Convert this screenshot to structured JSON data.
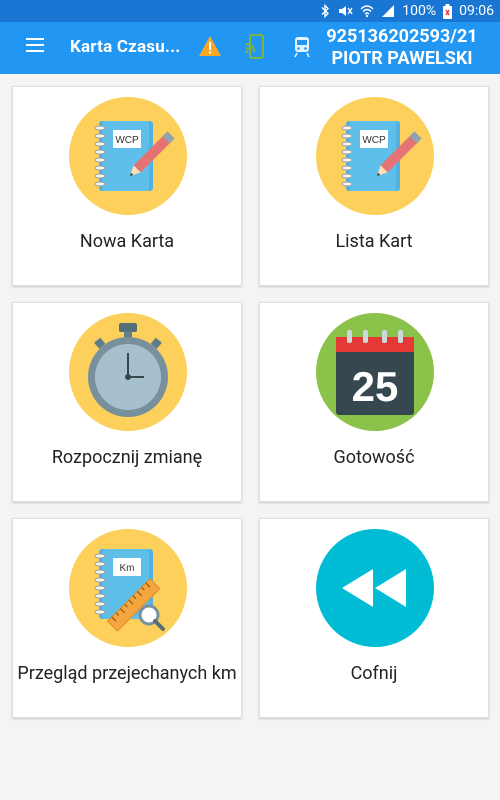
{
  "status_bar": {
    "battery": "100%",
    "time": "09:06",
    "icons": [
      "bluetooth-icon",
      "mute-icon",
      "wifi-icon",
      "signal-icon",
      "battery-icon"
    ]
  },
  "app_bar": {
    "title": "Karta Czasu...",
    "menu_icon": "hamburger-menu-icon",
    "warning_icon": "warning-icon",
    "cast_icon": "cast-icon",
    "train_icon": "train-icon",
    "user_number": "925136202593/21",
    "user_name": "PIOTR PAWELSKI"
  },
  "tiles": [
    {
      "label": "Nowa Karta",
      "icon": "notebook-pencil-icon",
      "badge": "WCP"
    },
    {
      "label": "Lista Kart",
      "icon": "notebook-pencil-icon",
      "badge": "WCP"
    },
    {
      "label": "Rozpocznij zmianę",
      "icon": "stopwatch-icon"
    },
    {
      "label": "Gotowość",
      "icon": "calendar-icon",
      "day": "25"
    },
    {
      "label": "Przegląd przejechanych km",
      "icon": "notebook-ruler-icon",
      "badge": "Km"
    },
    {
      "label": "Cofnij",
      "icon": "rewind-icon"
    }
  ],
  "colors": {
    "statusbar": "#1976d2",
    "appbar": "#2196f3",
    "yellow_circle": "#fdd05c",
    "green_circle": "#8bc34a",
    "teal_circle": "#00bcd4",
    "warning": "#f9a825"
  }
}
